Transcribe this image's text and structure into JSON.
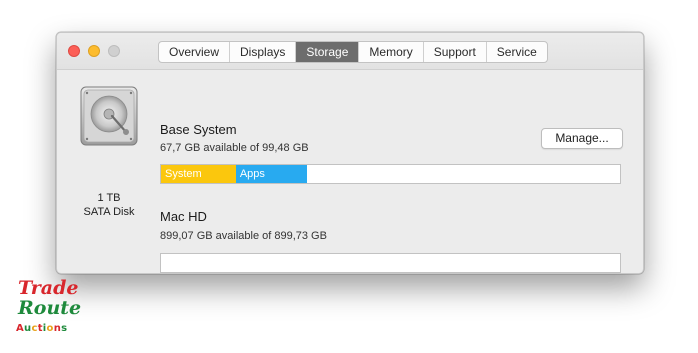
{
  "window": {
    "tabs": [
      {
        "label": "Overview",
        "active": false
      },
      {
        "label": "Displays",
        "active": false
      },
      {
        "label": "Storage",
        "active": true
      },
      {
        "label": "Memory",
        "active": false
      },
      {
        "label": "Support",
        "active": false
      },
      {
        "label": "Service",
        "active": false
      }
    ]
  },
  "disk": {
    "icon": "hard-drive-icon",
    "capacity": "1 TB",
    "type": "SATA Disk"
  },
  "volumes": [
    {
      "name": "Base System",
      "available": "67,7 GB available of 99,48 GB",
      "manage_label": "Manage...",
      "segments": [
        {
          "label": "System",
          "fraction": 0.163,
          "color": "#fbc70d"
        },
        {
          "label": "Apps",
          "fraction": 0.155,
          "color": "#28aaf0"
        }
      ]
    },
    {
      "name": "Mac HD",
      "available": "899,07 GB available of 899,73 GB",
      "segments": []
    }
  ],
  "watermark": {
    "line1": "Trade",
    "line2": "Route",
    "line3": "Auctions",
    "line3_colors": [
      "#d8262c",
      "#1e8a3c",
      "#e8a21a",
      "#d8262c",
      "#1e8a3c",
      "#e8a21a",
      "#d8262c",
      "#1e8a3c"
    ]
  }
}
